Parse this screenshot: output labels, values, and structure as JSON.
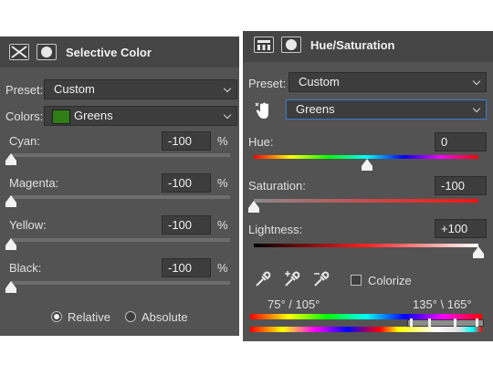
{
  "selective_color": {
    "title": "Selective Color",
    "preset_label": "Preset:",
    "preset_value": "Custom",
    "colors_label": "Colors:",
    "colors_value": "Greens",
    "unit": "%",
    "sliders": [
      {
        "label": "Cyan:",
        "value": "-100"
      },
      {
        "label": "Magenta:",
        "value": "-100"
      },
      {
        "label": "Yellow:",
        "value": "-100"
      },
      {
        "label": "Black:",
        "value": "-100"
      }
    ],
    "method_options": [
      {
        "label": "Relative",
        "checked": true
      },
      {
        "label": "Absolute",
        "checked": false
      }
    ]
  },
  "hue_saturation": {
    "title": "Hue/Saturation",
    "preset_label": "Preset:",
    "preset_value": "Custom",
    "channel_value": "Greens",
    "hue_label": "Hue:",
    "hue_value": "0",
    "saturation_label": "Saturation:",
    "saturation_value": "-100",
    "lightness_label": "Lightness:",
    "lightness_value": "+100",
    "colorize_label": "Colorize",
    "colorize_checked": false,
    "range_left": "75° / 105°",
    "range_right": "135° \\ 165°"
  },
  "icons": [
    "selective-color-mask-icon",
    "layer-mask-icon",
    "hue-sat-adjust-icon",
    "targeted-adjust-hand-icon",
    "eyedropper-icon",
    "eyedropper-plus-icon",
    "eyedropper-minus-icon"
  ]
}
